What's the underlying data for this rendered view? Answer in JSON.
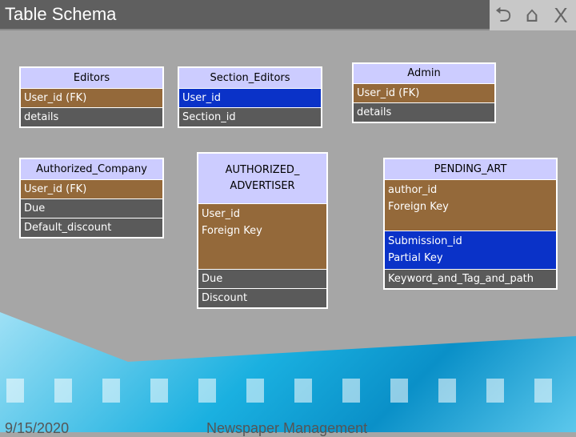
{
  "header": {
    "title": "Table Schema",
    "icons": [
      "back-icon",
      "home-icon",
      "close-icon"
    ],
    "close_label": "X"
  },
  "tables": [
    {
      "name": "Editors",
      "rows": [
        {
          "lines": [
            "User_id (FK)"
          ],
          "color": "brown"
        },
        {
          "lines": [
            "details"
          ],
          "color": "gray"
        }
      ]
    },
    {
      "name": "Section_Editors",
      "rows": [
        {
          "lines": [
            "User_id"
          ],
          "color": "blue"
        },
        {
          "lines": [
            "Section_id"
          ],
          "color": "gray"
        }
      ]
    },
    {
      "name": "Admin",
      "rows": [
        {
          "lines": [
            "User_id (FK)"
          ],
          "color": "brown"
        },
        {
          "lines": [
            "details"
          ],
          "color": "gray"
        }
      ]
    },
    {
      "name": "Authorized_Company",
      "rows": [
        {
          "lines": [
            "User_id (FK)"
          ],
          "color": "brown"
        },
        {
          "lines": [
            "Due"
          ],
          "color": "gray"
        },
        {
          "lines": [
            "Default_discount"
          ],
          "color": "gray"
        }
      ]
    },
    {
      "name": "AUTHORIZED_ ADVERTISER",
      "name_lines": [
        "AUTHORIZED_",
        "ADVERTISER"
      ],
      "rows": [
        {
          "lines": [
            "User_id",
            "Foreign Key"
          ],
          "color": "brown"
        },
        {
          "lines": [
            "Due"
          ],
          "color": "gray"
        },
        {
          "lines": [
            "Discount"
          ],
          "color": "gray"
        }
      ]
    },
    {
      "name": "PENDING_ART",
      "rows": [
        {
          "lines": [
            "author_id",
            "Foreign Key"
          ],
          "color": "brown"
        },
        {
          "lines": [
            "Submission_id",
            "Partial Key"
          ],
          "color": "blue"
        },
        {
          "lines": [
            "Keyword_and_Tag_and_path"
          ],
          "color": "gray"
        }
      ]
    }
  ],
  "footer": {
    "date": "9/15/2020",
    "title": "Newspaper Management"
  }
}
